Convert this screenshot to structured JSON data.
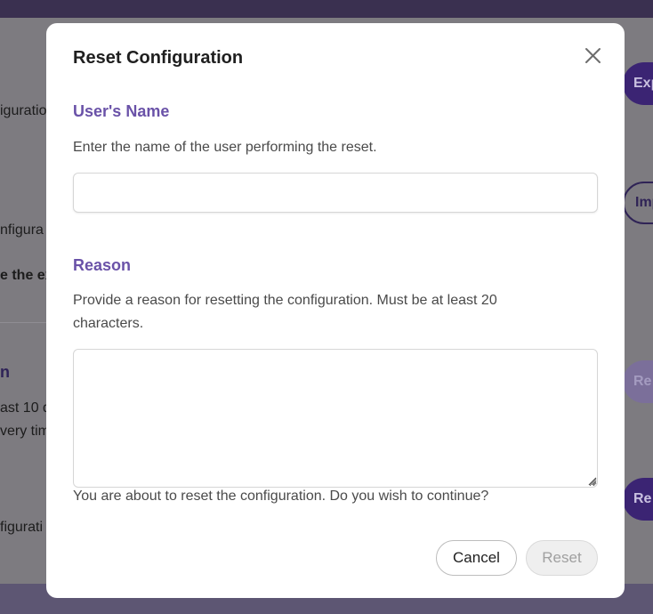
{
  "background": {
    "labels": [
      "iguratio",
      "nfigura",
      "e the ex",
      "n",
      "ast 10 d",
      "very tim",
      "figurati"
    ],
    "buttons": [
      "Exp",
      "Imp",
      "Re",
      "Re"
    ]
  },
  "modal": {
    "title": "Reset Configuration",
    "close_icon": "close-icon",
    "fields": {
      "user_name": {
        "label": "User's Name",
        "help": "Enter the name of the user performing the reset.",
        "value": "",
        "placeholder": ""
      },
      "reason": {
        "label": "Reason",
        "help": "Provide a reason for resetting the configuration. Must be at least 20 characters.",
        "value": "",
        "placeholder": ""
      }
    },
    "confirm_text": "You are about to reset the configuration. Do you wish to continue?",
    "actions": {
      "cancel_label": "Cancel",
      "reset_label": "Reset",
      "reset_disabled": true
    }
  },
  "colors": {
    "accent": "#6a52a8",
    "overlay": "#7d7b80",
    "header": "#3a3050"
  }
}
